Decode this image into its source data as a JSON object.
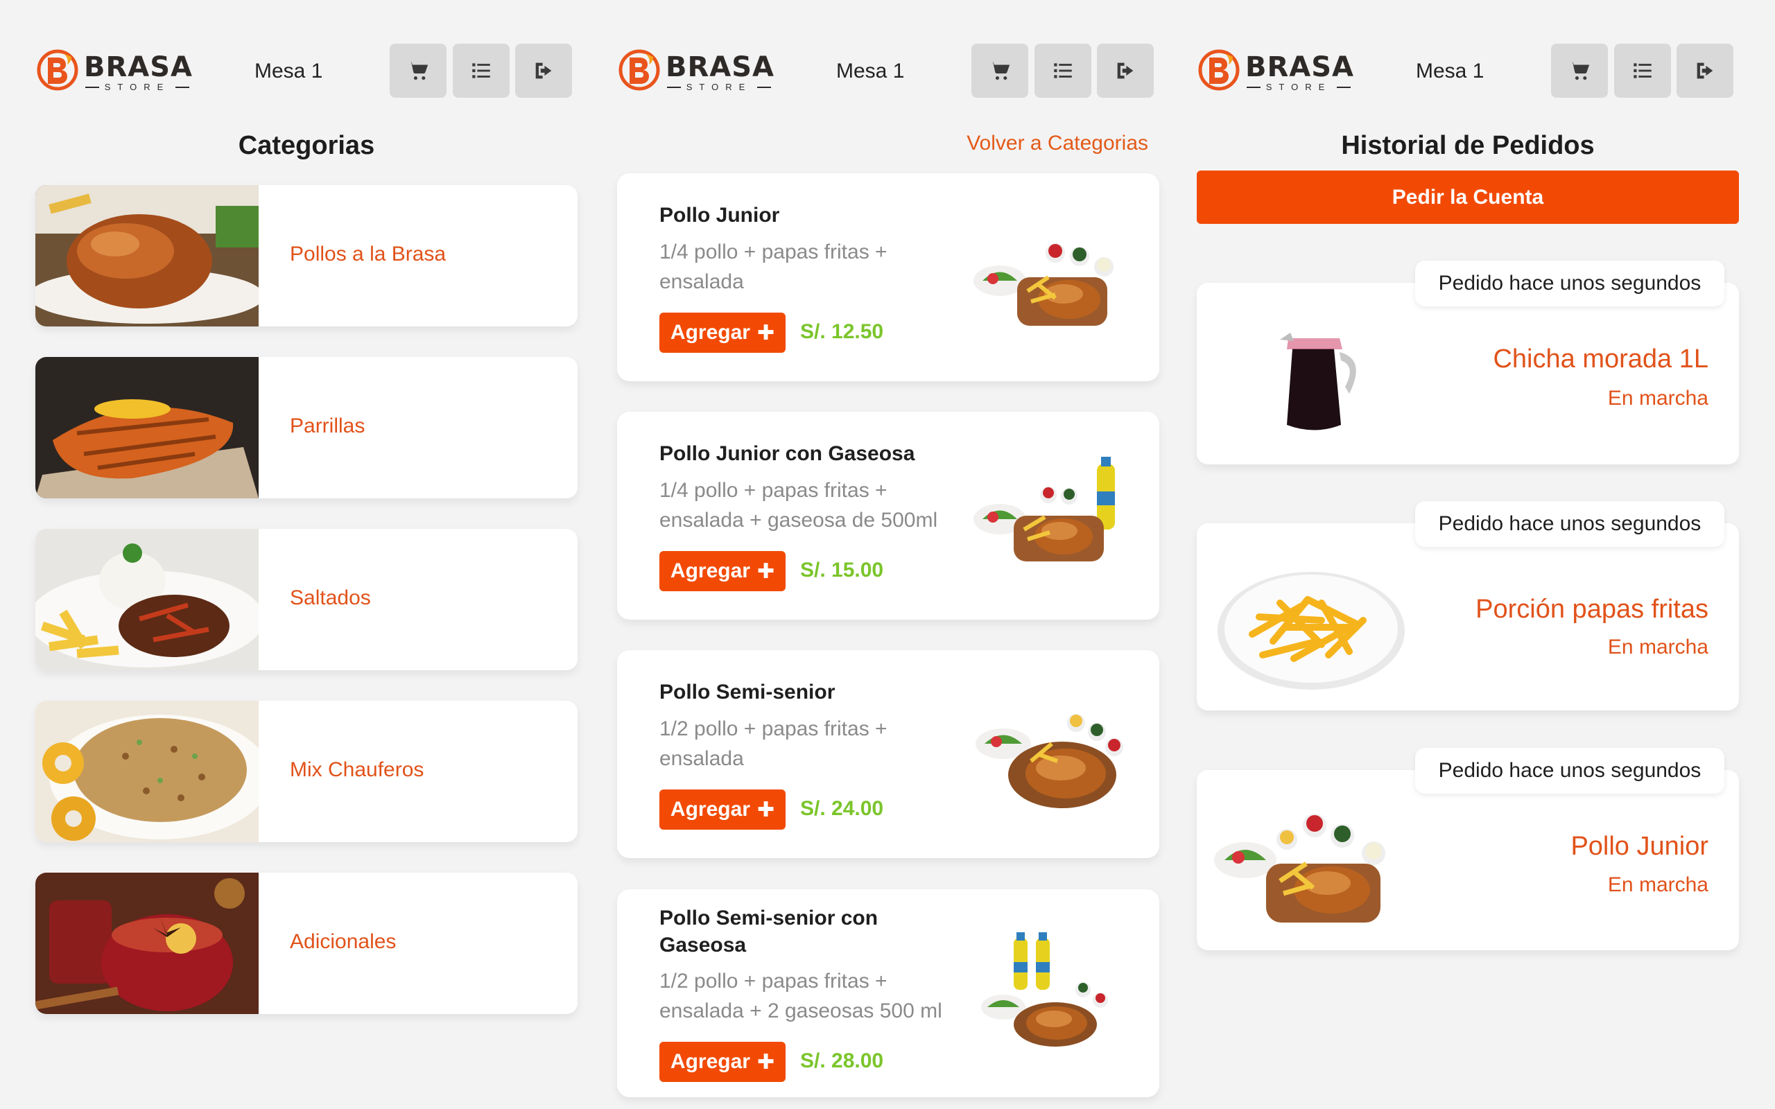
{
  "header": {
    "brand": "BRASA",
    "brand_sub": "STORE",
    "table_label": "Mesa 1",
    "icons": [
      "cart-icon",
      "list-icon",
      "logout-icon"
    ]
  },
  "categories_panel": {
    "title": "Categorias",
    "items": [
      {
        "label": "Pollos a la Brasa",
        "image": "roast-chicken"
      },
      {
        "label": "Parrillas",
        "image": "grilled-fish"
      },
      {
        "label": "Saltados",
        "image": "lomo-saltado"
      },
      {
        "label": "Mix Chauferos",
        "image": "fried-rice"
      },
      {
        "label": "Adicionales",
        "image": "hot-drinks"
      }
    ]
  },
  "products_panel": {
    "back_link": "Volver a Categorias",
    "add_label": "Agregar",
    "items": [
      {
        "name": "Pollo Junior",
        "desc": "1/4 pollo + papas fritas + ensalada",
        "price": "S/. 12.50"
      },
      {
        "name": "Pollo Junior con Gaseosa",
        "desc": "1/4 pollo + papas fritas + ensalada + gaseosa de 500ml",
        "price": "S/. 15.00"
      },
      {
        "name": "Pollo Semi-senior",
        "desc": "1/2 pollo + papas fritas + ensalada",
        "price": "S/. 24.00"
      },
      {
        "name": "Pollo Semi-senior con Gaseosa",
        "desc": "1/2 pollo + papas fritas + ensalada + 2 gaseosas 500 ml",
        "price": "S/. 28.00"
      }
    ]
  },
  "history_panel": {
    "title": "Historial de Pedidos",
    "bill_button": "Pedir la Cuenta",
    "orders": [
      {
        "time": "Pedido hace unos segundos",
        "name": "Chicha morada 1L",
        "status": "En marcha",
        "image": "pitcher"
      },
      {
        "time": "Pedido hace unos segundos",
        "name": "Porción papas fritas",
        "status": "En marcha",
        "image": "fries"
      },
      {
        "time": "Pedido hace unos segundos",
        "name": "Pollo Junior",
        "status": "En marcha",
        "image": "chicken-board"
      }
    ]
  },
  "colors": {
    "accent": "#f24a05",
    "accent_text": "#e1521a",
    "price": "#7bc52b",
    "background": "#f3f3f4",
    "header_button": "#d9d9da"
  }
}
